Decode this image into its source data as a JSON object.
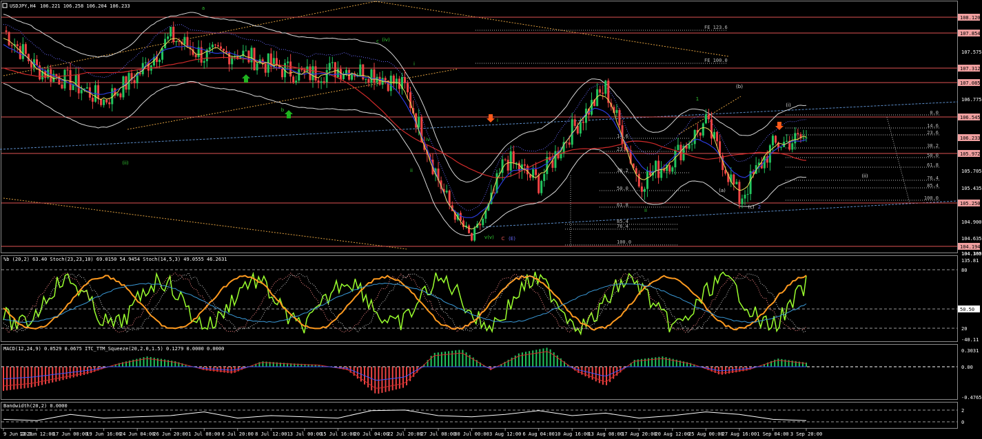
{
  "colors": {
    "bg": "#000000",
    "bull": "#22c55e",
    "bear": "#ef4444",
    "text": "#ffffff",
    "hline": "#e05555",
    "ma_red": "#d12a2a",
    "ma_blue": "#2b3bdc",
    "ma_yellow": "#e8e05a",
    "bands": "#d8d8d8",
    "fib": "#bbbbbb",
    "channel_blue": "#5b8cc8",
    "trend_orange": "#e0a040",
    "wave_green": "#33cc33",
    "wave_white": "#dddddd",
    "arrow_orange": "#ff5a1a",
    "price_tag_bg": "#f0a0a0",
    "stoch_orange": "#ff9a1f",
    "pctb_green": "#9aff2e",
    "stoch_blue": "#3a9ad9"
  },
  "header": {
    "symbol": "USDJPY,H4",
    "ohlc": "106.221 106.258 106.204 106.233"
  },
  "price_axis": {
    "ticks": [
      "108.120",
      "107.854",
      "107.575",
      "107.312",
      "107.085",
      "106.775",
      "106.545",
      "106.233",
      "105.972",
      "105.705",
      "105.435",
      "105.250",
      "104.900",
      "104.635",
      "104.365",
      "104.194",
      "104.100"
    ],
    "tags": [
      "108.120",
      "107.854",
      "107.312",
      "107.085",
      "106.545",
      "106.233",
      "105.972",
      "105.250",
      "104.194"
    ]
  },
  "horizontal_lines": [
    "108.120",
    "107.854",
    "107.312",
    "107.085",
    "106.545",
    "105.972",
    "105.250",
    "104.194"
  ],
  "time_axis": [
    "9 Jun 2020",
    "12 Jun 12:00",
    "17 Jun 00:00",
    "19 Jun 16:00",
    "24 Jun 04:00",
    "26 Jun 20:00",
    "1 Jul 08:00",
    "6 Jul 20:00",
    "8 Jul 12:00",
    "13 Jul 00:00",
    "15 Jul 16:00",
    "20 Jul 04:00",
    "22 Jul 20:00",
    "27 Jul 08:00",
    "30 Jul 00:00",
    "3 Aug 12:00",
    "6 Aug 04:00",
    "10 Aug 16:00",
    "13 Aug 08:00",
    "17 Aug 20:00",
    "20 Aug 12:00",
    "25 Aug 00:00",
    "27 Aug 16:00",
    "1 Sep 04:00",
    "3 Sep 20:00"
  ],
  "fib_top": {
    "fe1236": "FE 123.6",
    "fe100": "FE 100.0"
  },
  "fib_right": [
    "0.0",
    "14.6",
    "23.6",
    "38.2",
    "50.0",
    "61.8",
    "76.4",
    "85.4",
    "100.0"
  ],
  "fib_mid": [
    "14.6",
    "23.6",
    "38.2",
    "50.0",
    "61.8"
  ],
  "fib_bottom": [
    "76.4",
    "85.4",
    "100.0"
  ],
  "wave_labels": {
    "a": "a",
    "ii": "(ii)",
    "c": "c",
    "iv": "(iv)",
    "i_small": "i",
    "b": "b",
    "i_red_arrow": "i",
    "iv_small": "iv",
    "ii_roman": "ii",
    "v_paren": "(v)",
    "v_small": "v",
    "C": "C",
    "E": "(E)",
    "one": "1",
    "b_paren": "(b)",
    "i_paren": "(i)",
    "ii_paren_right": "(ii)",
    "a_paren": "(a)",
    "c_paren": "(c)",
    "two": "2",
    "ii_green": "ii"
  },
  "stoch_panel": {
    "title": "%b (20,2) 63.40  Stoch(23,23,10) 69.0150 54.9454  Stoch(14,5,3) 49.0555 46.2631",
    "ticks": [
      "135.81",
      "80",
      "50.50",
      "20",
      "-40.11"
    ]
  },
  "macd_panel": {
    "title": "MACD(12,24,9) 0.0529 0.0675  ITC_TTM_Squeeze(20,2.0,1.5) 0.1279 0.0000 0.0000",
    "ticks": [
      "0.3031",
      "0.00",
      "-0.4765"
    ]
  },
  "bw_panel": {
    "title": "Bandwidth(20,2) 0.0000",
    "ticks": [
      "2",
      "0"
    ]
  },
  "chart_data": {
    "type": "line",
    "title": "USDJPY,H4",
    "ylim": [
      104.1,
      108.3
    ],
    "x": [
      "9 Jun 2020",
      "12 Jun 12:00",
      "17 Jun 00:00",
      "19 Jun 16:00",
      "24 Jun 04:00",
      "26 Jun 20:00",
      "1 Jul 08:00",
      "6 Jul 20:00",
      "8 Jul 12:00",
      "13 Jul 00:00",
      "15 Jul 16:00",
      "20 Jul 04:00",
      "22 Jul 20:00",
      "27 Jul 08:00",
      "30 Jul 00:00",
      "3 Aug 12:00",
      "6 Aug 04:00",
      "10 Aug 16:00",
      "13 Aug 08:00",
      "17 Aug 20:00",
      "20 Aug 12:00",
      "25 Aug 00:00",
      "27 Aug 16:00",
      "1 Sep 04:00",
      "3 Sep 20:00"
    ],
    "series": [
      {
        "name": "Close",
        "values": [
          107.9,
          107.3,
          107.1,
          106.8,
          107.2,
          107.8,
          107.5,
          107.55,
          107.35,
          107.2,
          107.3,
          107.25,
          107.0,
          105.6,
          104.35,
          105.9,
          105.55,
          106.35,
          107.0,
          105.55,
          105.9,
          106.45,
          105.3,
          106.1,
          106.233
        ]
      }
    ]
  }
}
